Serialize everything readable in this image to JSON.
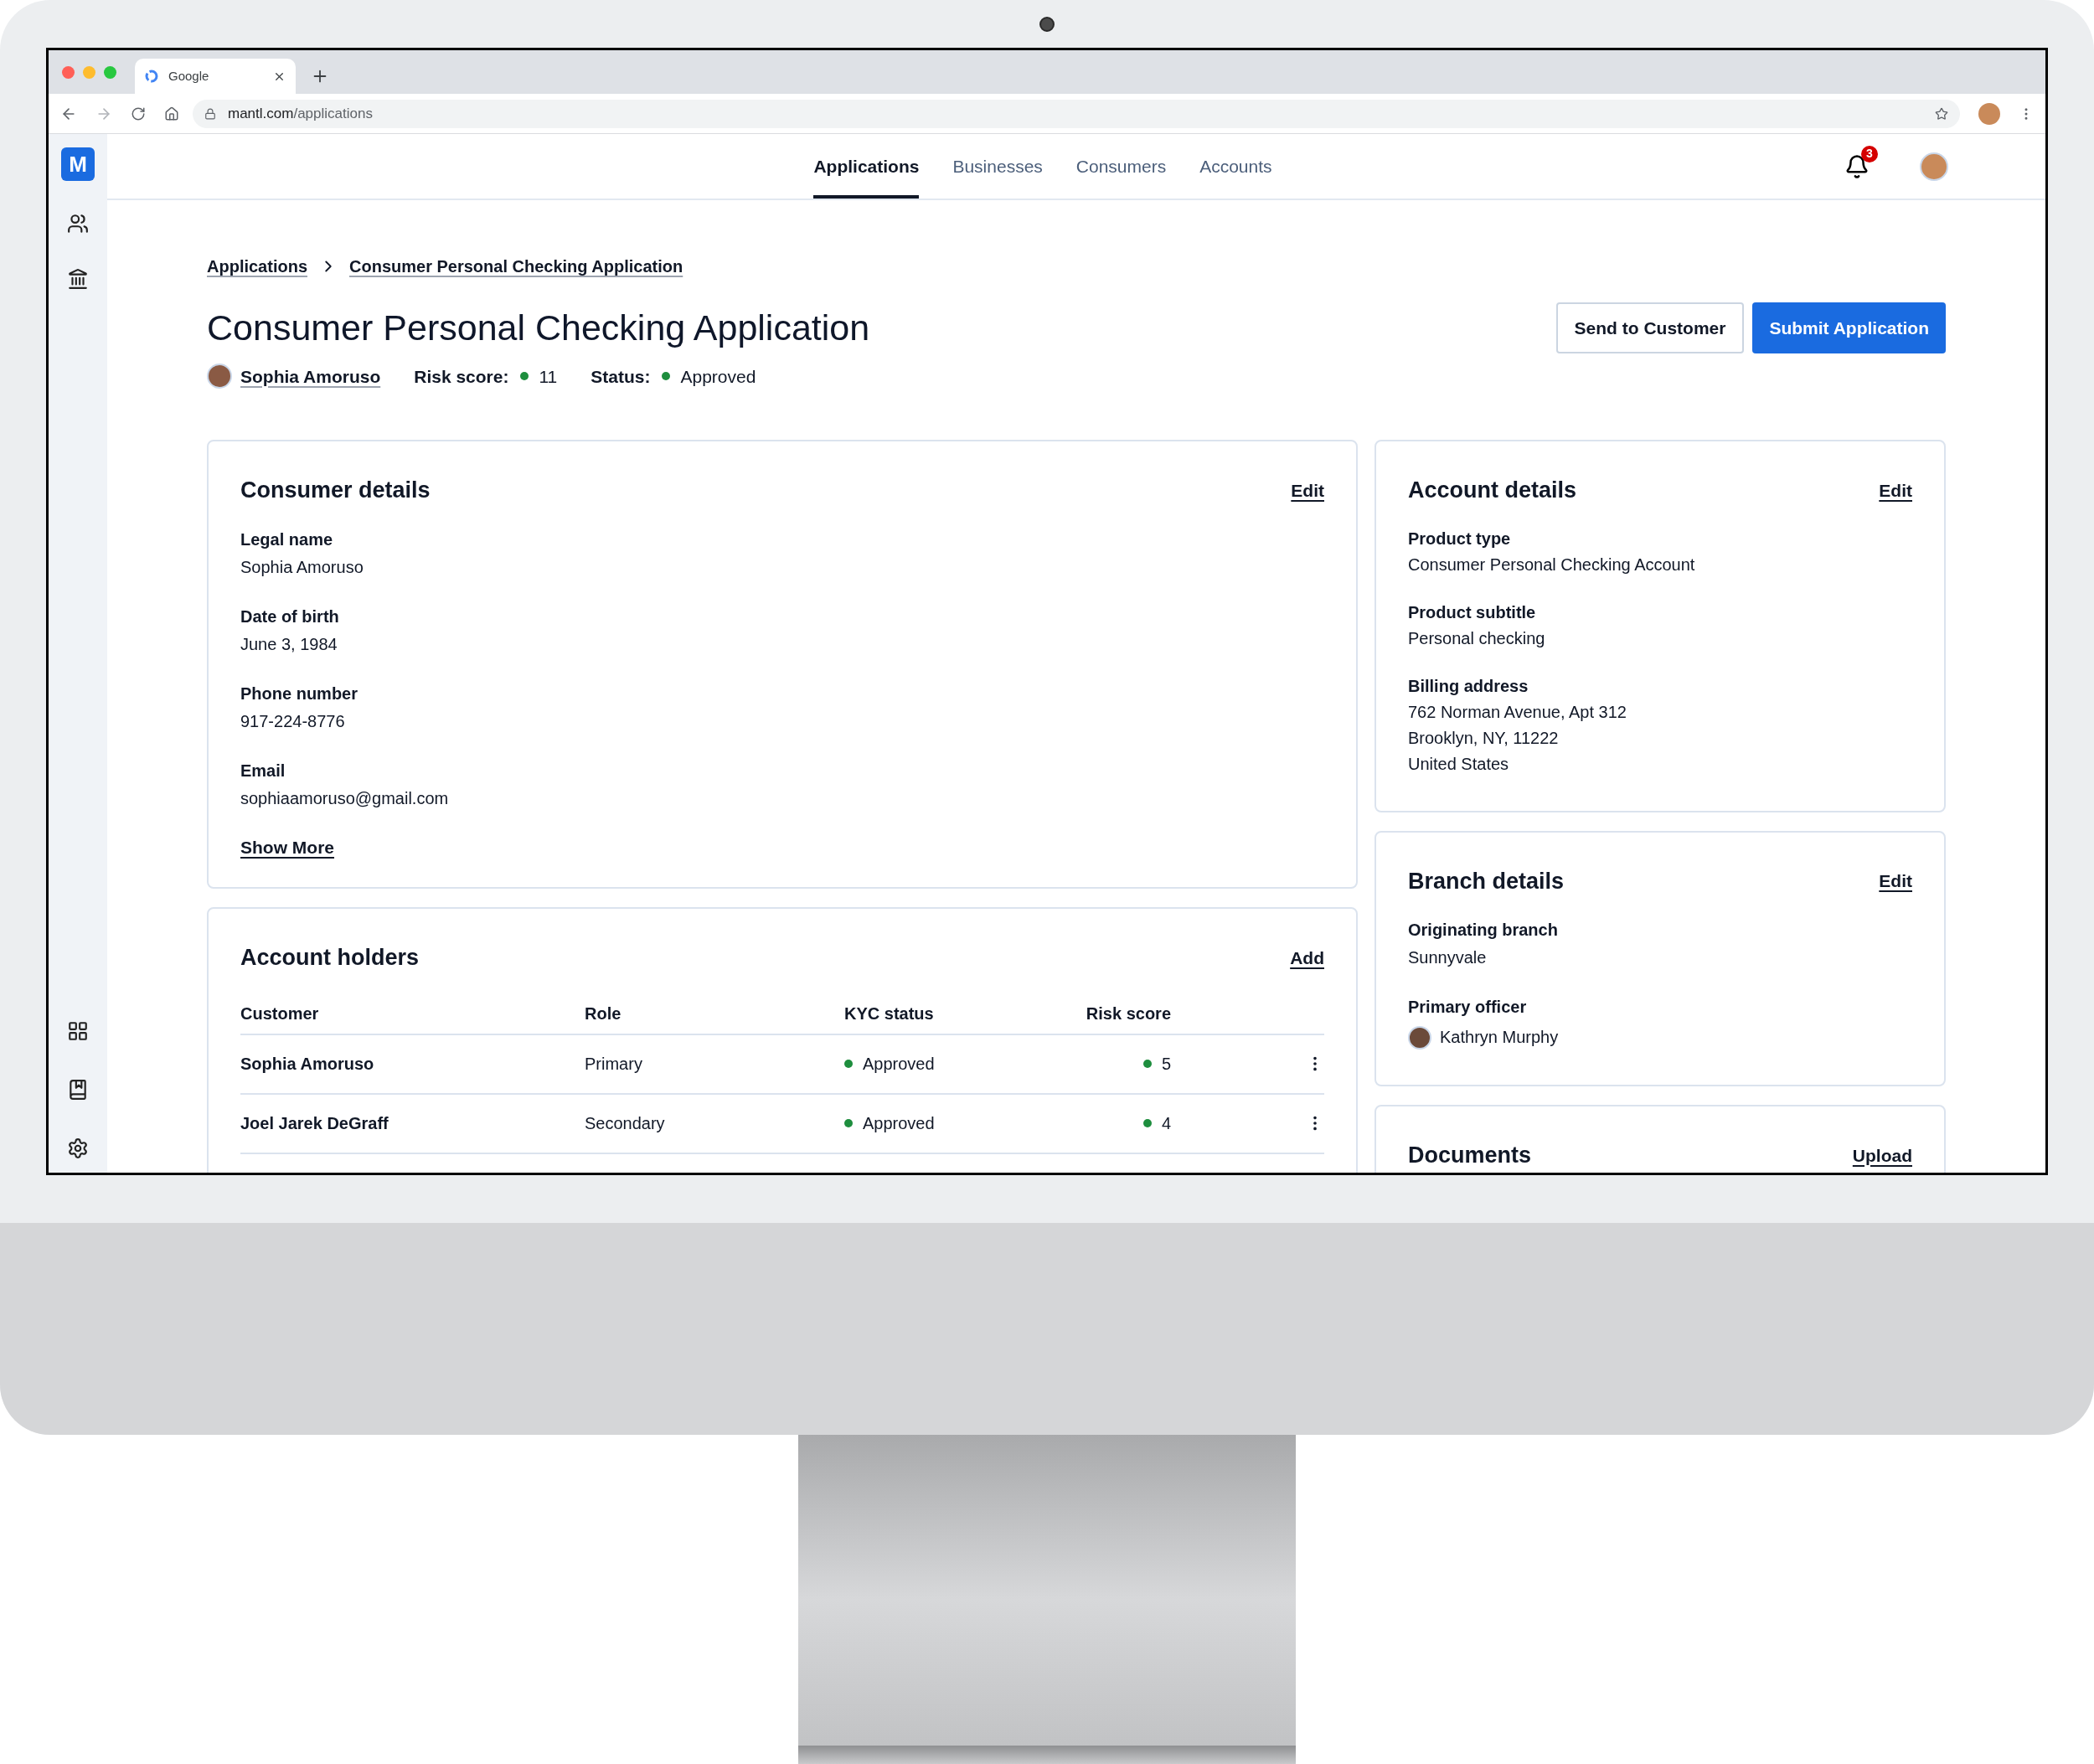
{
  "browser": {
    "tab_title": "Google",
    "url_host": "mantl.com",
    "url_path": "/applications"
  },
  "sidebar": {
    "logo": "M"
  },
  "nav": {
    "tabs": [
      {
        "label": "Applications",
        "selected": true
      },
      {
        "label": "Businesses",
        "selected": false
      },
      {
        "label": "Consumers",
        "selected": false
      },
      {
        "label": "Accounts",
        "selected": false
      }
    ],
    "notification_count": "3"
  },
  "breadcrumb": [
    "Applications",
    "Consumer Personal Checking Application"
  ],
  "title": "Consumer Personal Checking Application",
  "buttons": [
    {
      "label": "Send to Customer",
      "kind": "secondary"
    },
    {
      "label": "Submit Application",
      "kind": "primary"
    }
  ],
  "meta": {
    "customer": "Sophia Amoruso",
    "risk": {
      "label": "Risk score:",
      "value": "11",
      "color": "#1e8e3e"
    },
    "status": {
      "label": "Status:",
      "value": "Approved",
      "color": "#1e8e3e"
    }
  },
  "consumer_details": {
    "title": "Consumer details",
    "action": "Edit",
    "fields": [
      {
        "label": "Legal name",
        "value": "Sophia Amoruso"
      },
      {
        "label": "Date of birth",
        "value": "June 3, 1984"
      },
      {
        "label": "Phone number",
        "value": "917-224-8776"
      },
      {
        "label": "Email",
        "value": "sophiaamoruso@gmail.com"
      }
    ],
    "show_more": "Show More"
  },
  "account_holders": {
    "title": "Account holders",
    "action": "Add",
    "columns": [
      "Customer",
      "Role",
      "KYC status",
      "Risk score"
    ],
    "rows": [
      {
        "customer": "Sophia Amoruso",
        "role": "Primary",
        "kyc": {
          "text": "Approved",
          "color": "#1e8e3e"
        },
        "risk": {
          "text": "5",
          "color": "#1e8e3e"
        }
      },
      {
        "customer": "Joel Jarek DeGraff",
        "role": "Secondary",
        "kyc": {
          "text": "Approved",
          "color": "#1e8e3e"
        },
        "risk": {
          "text": "4",
          "color": "#1e8e3e"
        }
      }
    ]
  },
  "account_details": {
    "title": "Account details",
    "action": "Edit",
    "fields": [
      {
        "label": "Product type",
        "lines": [
          "Consumer Personal Checking Account"
        ]
      },
      {
        "label": "Product subtitle",
        "lines": [
          "Personal checking"
        ]
      },
      {
        "label": "Billing address",
        "lines": [
          "762 Norman Avenue, Apt 312",
          "Brooklyn, NY, 11222",
          "United States"
        ]
      }
    ]
  },
  "branch_details": {
    "title": "Branch details",
    "action": "Edit",
    "fields": [
      {
        "label": "Originating branch",
        "value": "Sunnyvale",
        "kind": "text"
      },
      {
        "label": "Primary officer",
        "value": "Kathryn Murphy",
        "kind": "person"
      }
    ]
  },
  "documents": {
    "title": "Documents",
    "action": "Upload"
  }
}
